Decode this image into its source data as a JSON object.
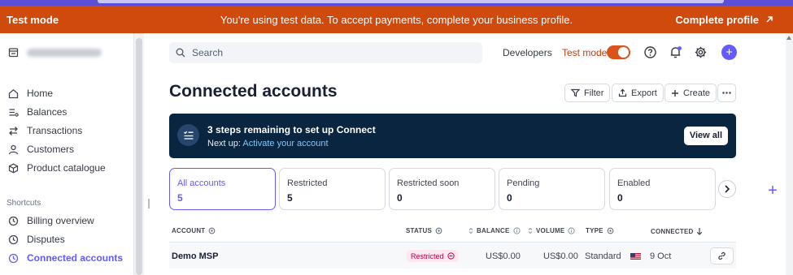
{
  "banner": {
    "mode_label": "Test mode",
    "message": "You're using test data. To accept payments, complete your business profile.",
    "action_label": "Complete profile"
  },
  "sidebar": {
    "nav": [
      {
        "label": "Home",
        "icon": "home-icon"
      },
      {
        "label": "Balances",
        "icon": "balances-icon"
      },
      {
        "label": "Transactions",
        "icon": "transactions-icon"
      },
      {
        "label": "Customers",
        "icon": "customers-icon"
      },
      {
        "label": "Product catalogue",
        "icon": "product-catalogue-icon"
      }
    ],
    "shortcuts_heading": "Shortcuts",
    "shortcuts": [
      {
        "label": "Billing overview",
        "icon": "clock-icon"
      },
      {
        "label": "Disputes",
        "icon": "clock-icon"
      },
      {
        "label": "Connected accounts",
        "icon": "clock-icon",
        "active": true
      }
    ]
  },
  "topbar": {
    "search_placeholder": "Search",
    "developers_label": "Developers",
    "test_mode_label": "Test mode",
    "test_mode_on": true
  },
  "page": {
    "title": "Connected accounts",
    "buttons": {
      "filter": "Filter",
      "export": "Export",
      "create": "Create"
    }
  },
  "setup_banner": {
    "heading": "3 steps remaining to set up Connect",
    "next_up_prefix": "Next up:",
    "next_up_link": "Activate your account",
    "view_all": "View all"
  },
  "filters": [
    {
      "label": "All accounts",
      "count": "5",
      "selected": true
    },
    {
      "label": "Restricted",
      "count": "5"
    },
    {
      "label": "Restricted soon",
      "count": "0"
    },
    {
      "label": "Pending",
      "count": "0"
    },
    {
      "label": "Enabled",
      "count": "0"
    }
  ],
  "table": {
    "headers": {
      "account": "ACCOUNT",
      "status": "STATUS",
      "balance": "BALANCE",
      "volume": "VOLUME",
      "type": "TYPE",
      "connected": "CONNECTED"
    },
    "rows": [
      {
        "account": "Demo MSP",
        "status": "Restricted",
        "balance": "US$0.00",
        "volume": "US$0.00",
        "type": "Standard",
        "country_flag": "us-flag-icon",
        "connected": "9 Oct"
      }
    ]
  },
  "colors": {
    "banner": "#cf4a0c",
    "accent": "#635bff",
    "setup_bg": "#0a2540",
    "restricted_bg": "#ffe7f2",
    "restricted_text": "#b3063d"
  }
}
